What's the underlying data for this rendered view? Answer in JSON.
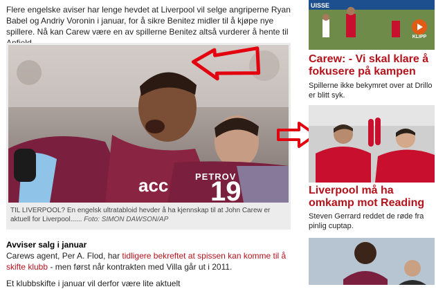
{
  "article": {
    "intro": "Flere engelske aviser har lenge hevdet at Liverpool vil selge angriperne Ryan Babel og Andriy Voronin i januar, for å sikre Benitez midler til å kjøpe nye spillere. Nå kan Carew være en av spillerne Benitez altså vurderer å hente til Anfield.",
    "photo": {
      "jersey_number": "19",
      "jersey_name": "PETROV",
      "sponsor": "acc",
      "caption": "TIL LIVERPOOL? En engelsk ultratabloid hevder å ha kjennskap til at John Carew er aktuell for Liverpool......",
      "credit": "Foto: SIMON DAWSON/AP"
    },
    "subhead": "Avviser salg i januar",
    "body_prefix": "Carews agent, Per A. Flod, har ",
    "body_link": "tidligere bekreftet at spissen kan komme til å skifte klubb",
    "body_suffix": " - men først når kontrakten med Villa går ut i 2011.",
    "body_cut": "Et klubbskifte i januar vil derfor være lite aktuelt"
  },
  "sidebar": {
    "top_thumb": {
      "strip_text": "UISSE",
      "video_label": "KLIPP"
    },
    "story1": {
      "headline": "Carew: - Vi skal klare å fokusere på kampen",
      "summary": "Spillerne ikke bekymret over at Drillo er blitt syk."
    },
    "story2": {
      "headline": "Liverpool må ha omkamp mot Reading",
      "summary": "Steven Gerrard reddet de røde fra pinlig cuptap."
    },
    "bottom_thumb": {
      "strip_text": ""
    }
  },
  "colors": {
    "accent_red": "#b5121b",
    "arrow_red": "#e3000f",
    "villa_claret": "#7a1f3d",
    "villa_blue": "#8fc3e8",
    "liverpool_red": "#c8102e"
  }
}
